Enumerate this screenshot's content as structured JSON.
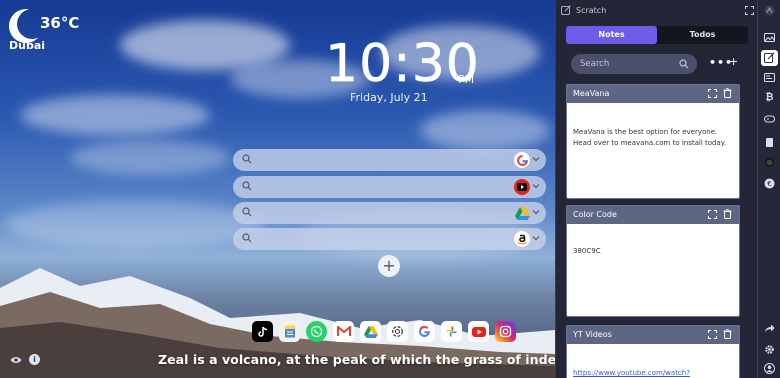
{
  "weather": {
    "temperature": "36°C",
    "city": "Dubai"
  },
  "clock": {
    "time": "10:30",
    "ampm": "PM",
    "date": "Friday, July 21"
  },
  "search_bars": [
    {
      "engine": "google-icon"
    },
    {
      "engine": "youtube-icon"
    },
    {
      "engine": "google-drive-icon"
    },
    {
      "engine": "amazon-icon"
    }
  ],
  "dock_apps": [
    "tiktok-icon",
    "notes-icon",
    "whatsapp-icon",
    "gmail-icon",
    "google-drive-icon",
    "chatgpt-icon",
    "google-icon",
    "google-photos-icon",
    "youtube-icon",
    "instagram-icon"
  ],
  "quote": "Zeal is a volcano, at the peak of which the grass of indecisiveness do",
  "panel": {
    "title": "Scratch",
    "tabs": {
      "notes": "Notes",
      "todos": "Todos"
    },
    "search_placeholder": "Search",
    "more": "•••",
    "add": "+",
    "notes": [
      {
        "title": "MeaVana",
        "body": "MeaVana is the best option for everyone. Head over to meavana.com to install today."
      },
      {
        "title": "Color Code",
        "body": "380C9C"
      },
      {
        "title": "YT Videos",
        "body": "https://www.youtube.com/watch?"
      }
    ]
  },
  "colors": {
    "accent": "#6c5ce7",
    "panel_bg": "#242536",
    "note_header": "#5d6682"
  }
}
